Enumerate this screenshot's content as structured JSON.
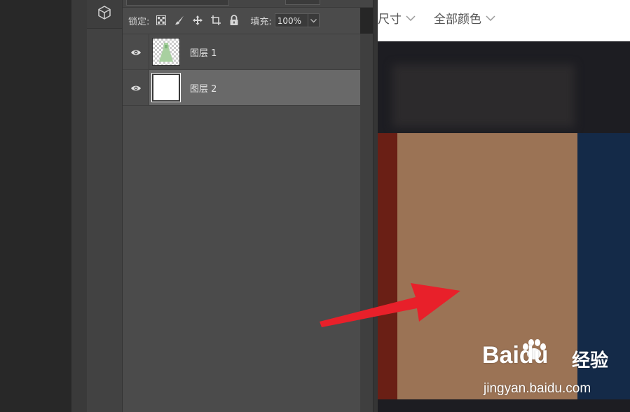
{
  "layers_panel": {
    "lock_label": "锁定:",
    "lock_icons": [
      "lock-transparent-pixels-icon",
      "lock-image-pixels-icon",
      "lock-position-icon",
      "lock-artboard-icon",
      "lock-all-icon"
    ],
    "fill_label": "填充:",
    "fill_value": "100%",
    "layers": [
      {
        "name": "图层 1",
        "visible": true,
        "selected": false,
        "thumbnail": "transparent-with-dress"
      },
      {
        "name": "图层 2",
        "visible": true,
        "selected": true,
        "thumbnail": "white"
      }
    ]
  },
  "web_page": {
    "nav": [
      {
        "label": "尺寸"
      },
      {
        "label": "全部颜色"
      }
    ],
    "swatch_colors": [
      "#6a1f15",
      "#9b7355",
      "#142a48"
    ]
  },
  "annotation": {
    "arrow_color": "#e8202a"
  },
  "watermark": {
    "logo": "Baidu",
    "logo_cn": "经验",
    "url": "jingyan.baidu.com"
  }
}
